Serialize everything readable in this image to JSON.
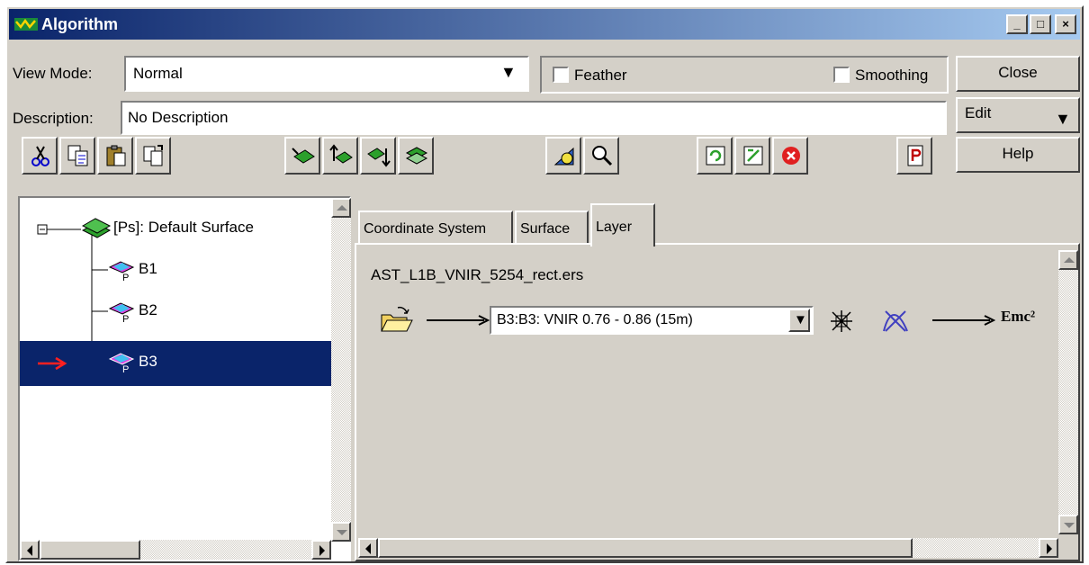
{
  "window": {
    "title": "Algorithm",
    "minimize": "_",
    "maximize": "□",
    "close": "×"
  },
  "view_mode": {
    "label": "View Mode:",
    "value": "Normal"
  },
  "feather": {
    "label": "Feather",
    "checked": false
  },
  "smoothing": {
    "label": "Smoothing",
    "checked": false
  },
  "description": {
    "label": "Description:",
    "value": "No Description"
  },
  "side_buttons": {
    "close": "Close",
    "edit": "Edit",
    "help": "Help"
  },
  "toolbar": {
    "icons": [
      "cut-icon",
      "copy-icon",
      "paste-icon",
      "paste-special-icon",
      "add-surface-icon",
      "move-up-icon",
      "move-down-icon",
      "duplicate-surface-icon",
      "add-layer-icon",
      "zoom-icon",
      "refresh-icon",
      "swap-icon",
      "stop-icon",
      "print-icon"
    ]
  },
  "tree": {
    "root": "[Ps]: Default Surface",
    "items": [
      "B1",
      "B2",
      "B3"
    ],
    "selected_index": 2
  },
  "tabs": [
    "Coordinate System",
    "Surface",
    "Layer"
  ],
  "active_tab": "Layer",
  "layer": {
    "file": "AST_L1B_VNIR_5254_rect.ers",
    "band_select": "B3:B3: VNIR 0.76 - 0.86 (15m)",
    "formula_icon": "Emc²"
  }
}
